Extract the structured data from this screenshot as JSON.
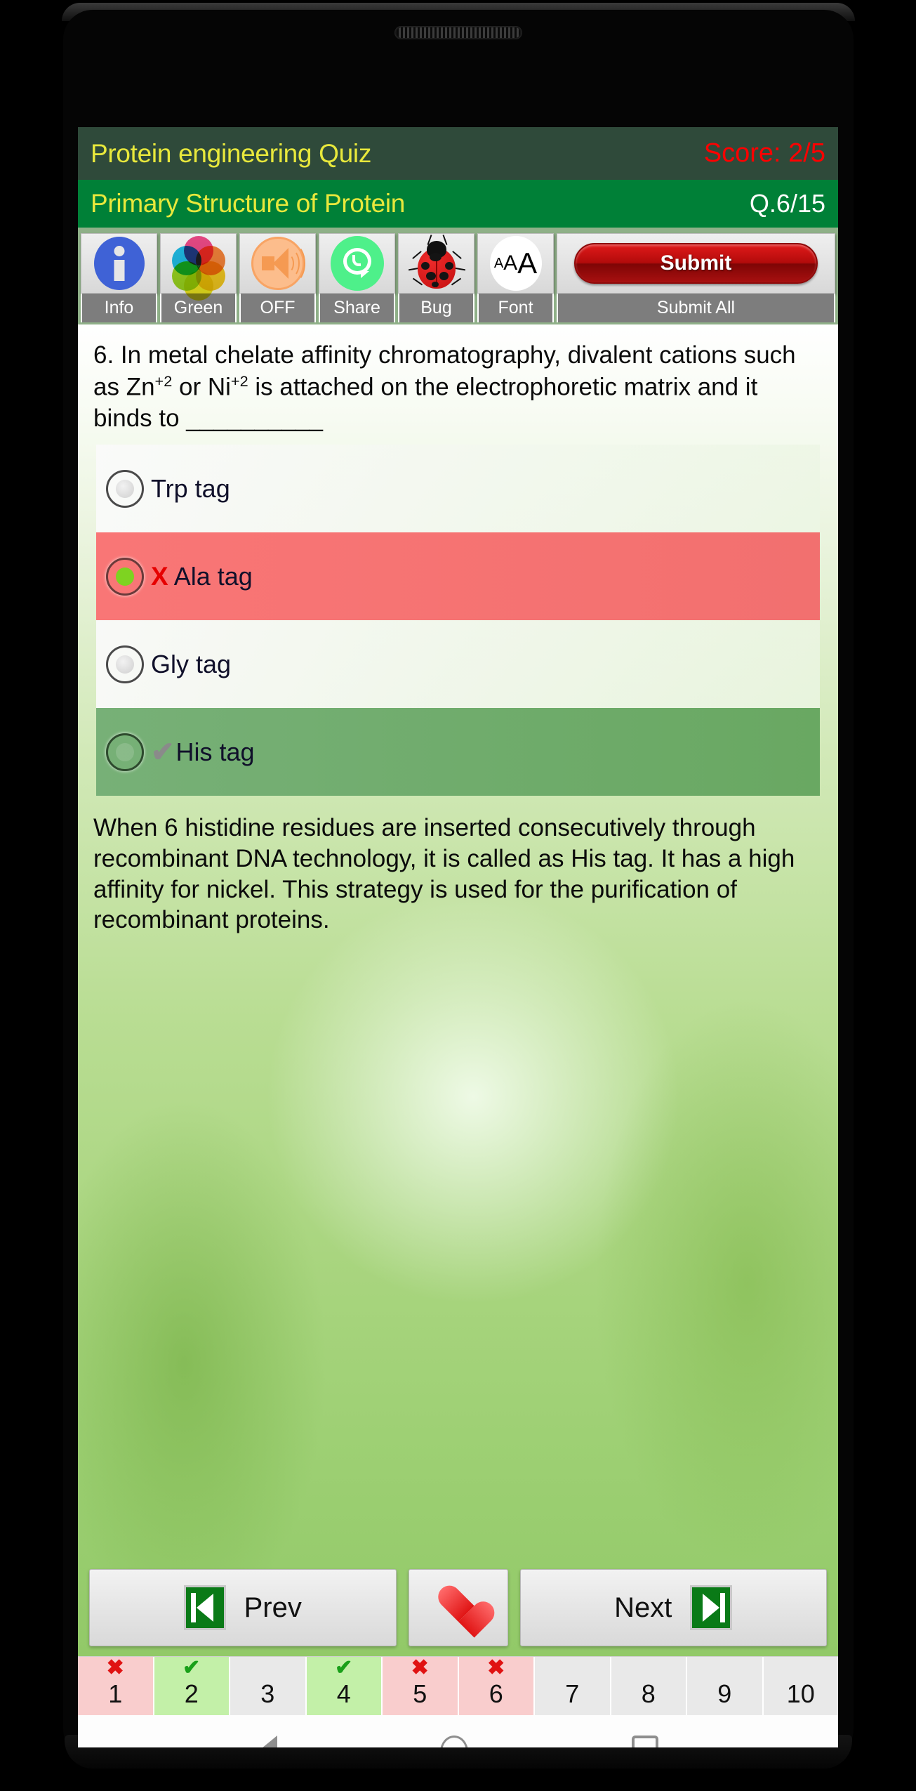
{
  "header": {
    "quiz_title": "Protein engineering Quiz",
    "score_label": "Score: 2/5",
    "topic": "Primary Structure of Protein",
    "question_counter": "Q.6/15",
    "title_color": "#e8e83c",
    "score_color": "#ff0000",
    "topbar_color": "#2f4a3a",
    "subbar_color": "#008037"
  },
  "toolbar": {
    "items": [
      {
        "label": "Info",
        "icon": "info-icon"
      },
      {
        "label": "Green",
        "icon": "color-wheel-icon"
      },
      {
        "label": "OFF",
        "icon": "speaker-icon"
      },
      {
        "label": "Share",
        "icon": "whatsapp-icon"
      },
      {
        "label": "Bug",
        "icon": "ladybug-icon"
      },
      {
        "label": "Font",
        "icon": "font-size-icon"
      },
      {
        "label": "Submit All",
        "icon": "submit-button",
        "button_text": "Submit"
      }
    ]
  },
  "question": {
    "number": "6.",
    "line1": "6. In metal chelate affinity chromatography,",
    "text_part1": "6. In metal chelate affinity chromatography, divalent cations such as Zn",
    "sup1": "+2",
    "text_part2": " or Ni",
    "sup2": "+2",
    "text_part3": " is attached on the electrophoretic matrix and it binds to __________"
  },
  "options": [
    {
      "label": "Trp tag",
      "state": "neutral",
      "selected": false,
      "mark": ""
    },
    {
      "label": "Ala tag",
      "state": "wrong",
      "selected": true,
      "mark": "X"
    },
    {
      "label": "Gly tag",
      "state": "neutral",
      "selected": false,
      "mark": ""
    },
    {
      "label": "His tag",
      "state": "correct",
      "selected": false,
      "mark": "✔"
    }
  ],
  "explanation": "When 6 histidine residues are inserted consecutively through recombinant DNA technology, it is called as His tag. It has a high affinity for nickel. This strategy is used for the purification of recombinant proteins.",
  "navigation": {
    "prev_label": "Prev",
    "next_label": "Next",
    "favorite_icon": "heart-icon",
    "prev_icon": "skip-previous-icon",
    "next_icon": "skip-next-icon"
  },
  "question_strip": [
    {
      "num": "1",
      "status": "wrong"
    },
    {
      "num": "2",
      "status": "correct"
    },
    {
      "num": "3",
      "status": "none"
    },
    {
      "num": "4",
      "status": "correct"
    },
    {
      "num": "5",
      "status": "wrong"
    },
    {
      "num": "6",
      "status": "wrong"
    },
    {
      "num": "7",
      "status": "none"
    },
    {
      "num": "8",
      "status": "none"
    },
    {
      "num": "9",
      "status": "none"
    },
    {
      "num": "10",
      "status": "none"
    }
  ],
  "system_nav": {
    "back": "back-icon",
    "home": "home-icon",
    "recents": "recents-icon"
  }
}
